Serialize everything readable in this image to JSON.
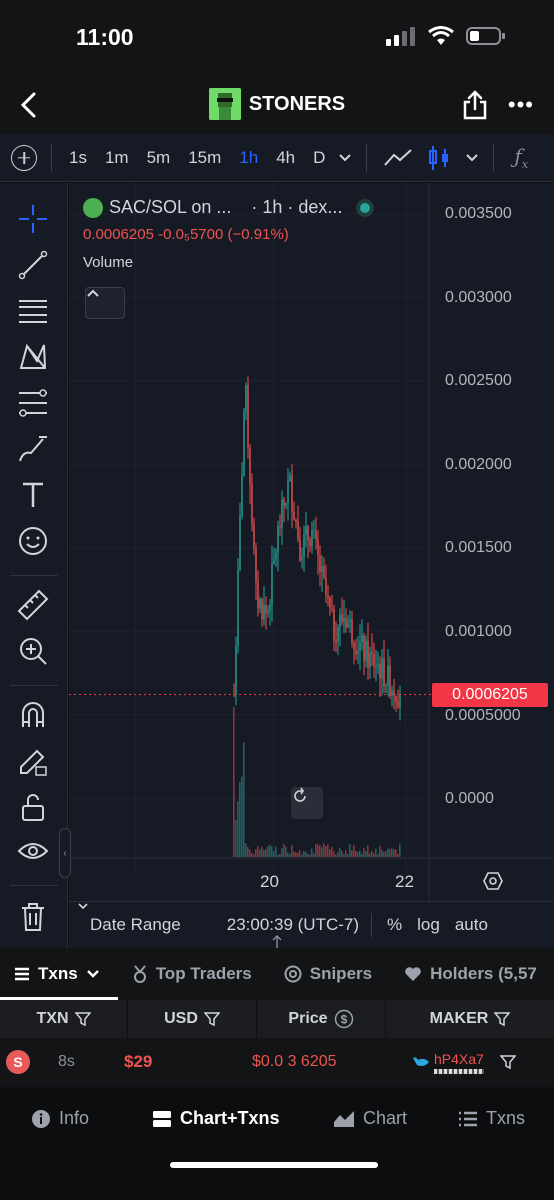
{
  "status": {
    "time": "11:00"
  },
  "nav": {
    "title": "STONERS"
  },
  "intervals": {
    "items": [
      "1s",
      "1m",
      "5m",
      "15m",
      "1h",
      "4h",
      "D"
    ],
    "active": "1h"
  },
  "legend": {
    "pair": "SAC/SOL on ...",
    "interval_source": "· 1h · dex...",
    "price_change": "0.0006205  -0.0₅5700 (−0.91%)",
    "indicator": "Volume"
  },
  "chart": {
    "price_axis": [
      "0.003500",
      "0.003000",
      "0.002500",
      "0.002000",
      "0.001500",
      "0.001000",
      "0.0005000",
      "0.0000"
    ],
    "current_price": "0.0006205",
    "x_axis": [
      "20",
      "22"
    ],
    "date_range_label": "Date Range",
    "time": "23:00:39 (UTC-7)",
    "percent": "%",
    "log": "log",
    "auto": "auto",
    "colors": {
      "up": "#26a69a",
      "down": "#ef5350",
      "bg": "#161a25"
    }
  },
  "chart_data": {
    "type": "candlestick",
    "ylim": [
      0,
      0.0035
    ],
    "x_ticks": [
      "20",
      "22"
    ],
    "current_price": 0.0006205,
    "approx_close_path": [
      0.00062,
      0.0025,
      0.0012,
      0.0011,
      0.0016,
      0.0019,
      0.0015,
      0.0016,
      0.0013,
      0.001,
      0.0011,
      0.00095,
      0.00085,
      0.0008,
      0.0007,
      0.00062
    ]
  },
  "tabs": [
    {
      "label": "Txns",
      "active": true
    },
    {
      "label": "Top Traders",
      "active": false
    },
    {
      "label": "Snipers",
      "active": false
    },
    {
      "label": "Holders (5,57",
      "active": false
    }
  ],
  "table": {
    "headers": [
      "TXN",
      "USD",
      "Price",
      "MAKER"
    ],
    "rows": [
      {
        "type": "S",
        "age": "8s",
        "usd": "$29",
        "price": "$0.0 3 6205",
        "maker": "hP4Xa7"
      }
    ]
  },
  "bottom_nav": [
    {
      "label": "Info",
      "active": false
    },
    {
      "label": "Chart+Txns",
      "active": true
    },
    {
      "label": "Chart",
      "active": false
    },
    {
      "label": "Txns",
      "active": false
    }
  ]
}
